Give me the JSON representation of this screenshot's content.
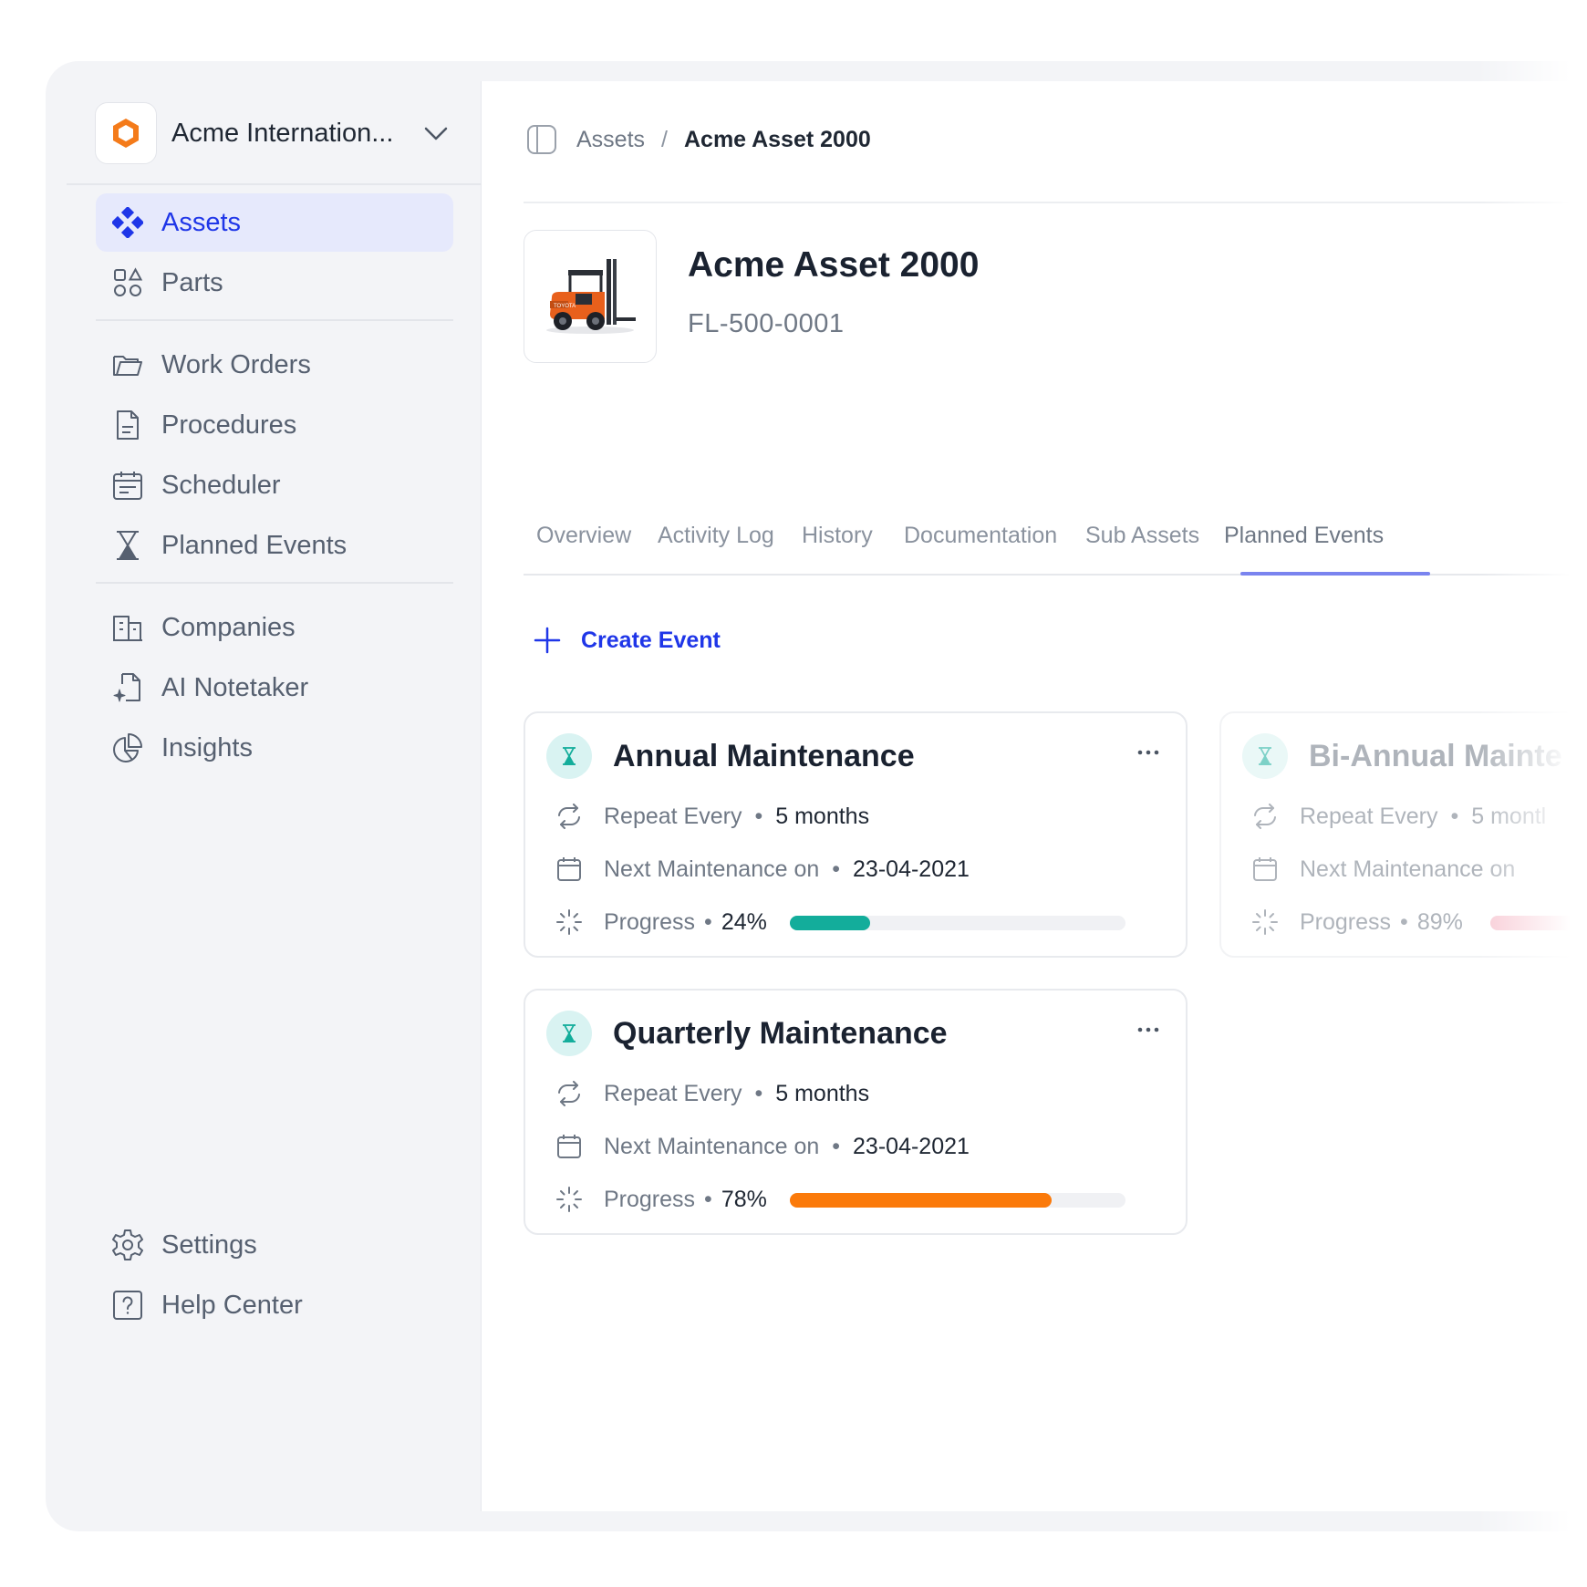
{
  "org": {
    "name": "Acme Internation...",
    "logo_color": "#f47b1a"
  },
  "sidebar": {
    "items": [
      {
        "label": "Assets",
        "icon": "assets-icon",
        "active": true
      },
      {
        "label": "Parts",
        "icon": "parts-icon"
      },
      {
        "label": "Work Orders",
        "icon": "folder-icon"
      },
      {
        "label": "Procedures",
        "icon": "document-icon"
      },
      {
        "label": "Scheduler",
        "icon": "calendar-icon"
      },
      {
        "label": "Planned Events",
        "icon": "hourglass-icon"
      },
      {
        "label": "Companies",
        "icon": "building-icon"
      },
      {
        "label": "AI Notetaker",
        "icon": "ai-note-icon"
      },
      {
        "label": "Insights",
        "icon": "pie-chart-icon"
      }
    ],
    "footer": [
      {
        "label": "Settings",
        "icon": "gear-icon"
      },
      {
        "label": "Help Center",
        "icon": "help-icon"
      }
    ]
  },
  "breadcrumb": {
    "parent": "Assets",
    "separator": "/",
    "current": "Acme Asset 2000"
  },
  "asset": {
    "title": "Acme Asset 2000",
    "code": "FL-500-0001",
    "thumb_text": "TOYOTA"
  },
  "tabs": [
    {
      "label": "Overview"
    },
    {
      "label": "Activity Log"
    },
    {
      "label": "History"
    },
    {
      "label": "Documentation"
    },
    {
      "label": "Sub Assets"
    },
    {
      "label": "Planned Events",
      "active": true
    }
  ],
  "actions": {
    "create_event": "Create Event"
  },
  "events": [
    {
      "title": "Annual Maintenance",
      "repeat_label": "Repeat Every",
      "repeat_value": "5 months",
      "next_label": "Next Maintenance on",
      "next_value": "23-04-2021",
      "progress_label": "Progress",
      "progress_value": "24%",
      "progress": 0.24,
      "progress_color": "#13ad9b"
    },
    {
      "title": "Bi-Annual Mainte",
      "repeat_label": "Repeat Every",
      "repeat_value": "5 montl",
      "next_label": "Next Maintenance on",
      "next_value": "",
      "progress_label": "Progress",
      "progress_value": "89%",
      "progress": 0.89,
      "progress_color": "#f3a3b6"
    },
    {
      "title": "Quarterly Maintenance",
      "repeat_label": "Repeat Every",
      "repeat_value": "5 months",
      "next_label": "Next Maintenance on",
      "next_value": "23-04-2021",
      "progress_label": "Progress",
      "progress_value": "78%",
      "progress": 0.78,
      "progress_color": "#fb7a0a"
    }
  ],
  "colors": {
    "accent": "#1f36e8",
    "active_bg": "#e6e9fc",
    "teal_icon_bg": "#d9f3f2",
    "teal_icon": "#13ad9b"
  }
}
